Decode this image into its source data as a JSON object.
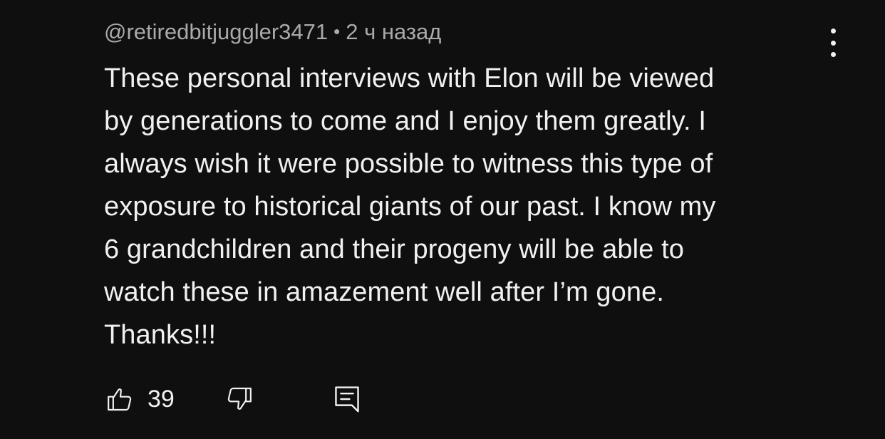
{
  "comment": {
    "author": "@retiredbitjuggler3471",
    "separator": "•",
    "time": "2 ч назад",
    "lines": [
      "These personal interviews with Elon will be viewed",
      "by generations to come and I enjoy them greatly. I",
      "always wish it were possible to witness this type of",
      "exposure to historical giants of our past. I know my",
      "6 grandchildren and their progeny will be able to",
      "watch these in amazement well after I’m gone.",
      "Thanks!!!"
    ]
  },
  "actions": {
    "like_count": "39",
    "like_icon": "thumbs-up-icon",
    "dislike_icon": "thumbs-down-icon",
    "reply_icon": "reply-comment-icon"
  },
  "menu": {
    "icon": "more-vertical-icon"
  },
  "colors": {
    "background": "#0f0f10",
    "text": "#f1f1f1",
    "meta": "#aaaaaa"
  }
}
